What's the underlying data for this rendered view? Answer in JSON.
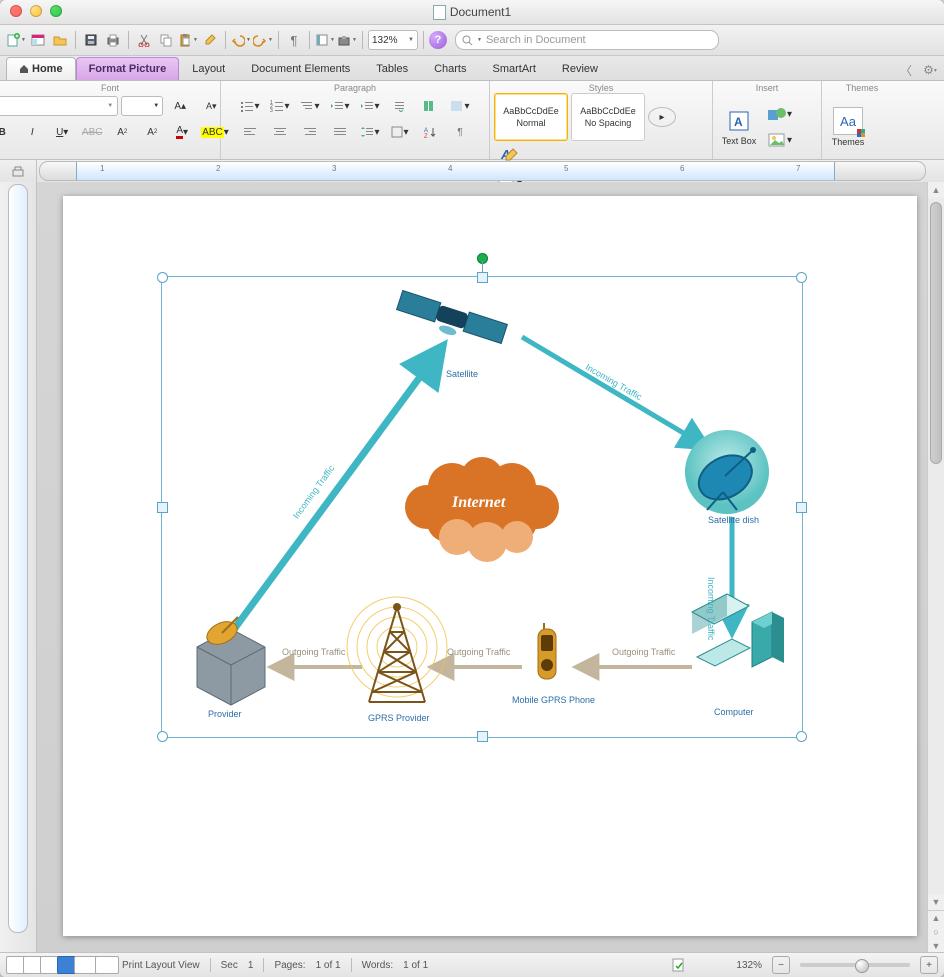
{
  "window": {
    "title": "Document1"
  },
  "qat": {
    "zoom": "132%",
    "searchPlaceholder": "Search in Document",
    "help": "?"
  },
  "tabs": {
    "home": "Home",
    "context": "Format Picture",
    "items": [
      "Layout",
      "Document Elements",
      "Tables",
      "Charts",
      "SmartArt",
      "Review"
    ]
  },
  "ribbon": {
    "groups": {
      "font": "Font",
      "paragraph": "Paragraph",
      "styles": "Styles",
      "insert": "Insert",
      "themes": "Themes"
    },
    "styles": {
      "preview": "AaBbCcDdEe",
      "normal": "Normal",
      "nospacing": "No Spacing"
    },
    "insert": {
      "textbox": "Text Box"
    },
    "themes": {
      "label": "Themes",
      "swatch": "Aa"
    }
  },
  "ruler": {
    "marks": [
      "1",
      "2",
      "3",
      "4",
      "5",
      "6",
      "7"
    ]
  },
  "diagram": {
    "nodes": {
      "satellite": "Satellite",
      "dish": "Satellite dish",
      "computer": "Computer",
      "phone": "Mobile GPRS Phone",
      "gprs": "GPRS Provider",
      "provider": "Provider",
      "internet": "Internet"
    },
    "edges": {
      "incoming": "Incoming Traffic",
      "outgoing": "Outgoing Traffic"
    }
  },
  "status": {
    "viewName": "Print Layout View",
    "secLabel": "Sec",
    "secVal": "1",
    "pagesLabel": "Pages:",
    "pagesVal": "1 of 1",
    "wordsLabel": "Words:",
    "wordsVal": "1 of 1",
    "zoom": "132%"
  }
}
